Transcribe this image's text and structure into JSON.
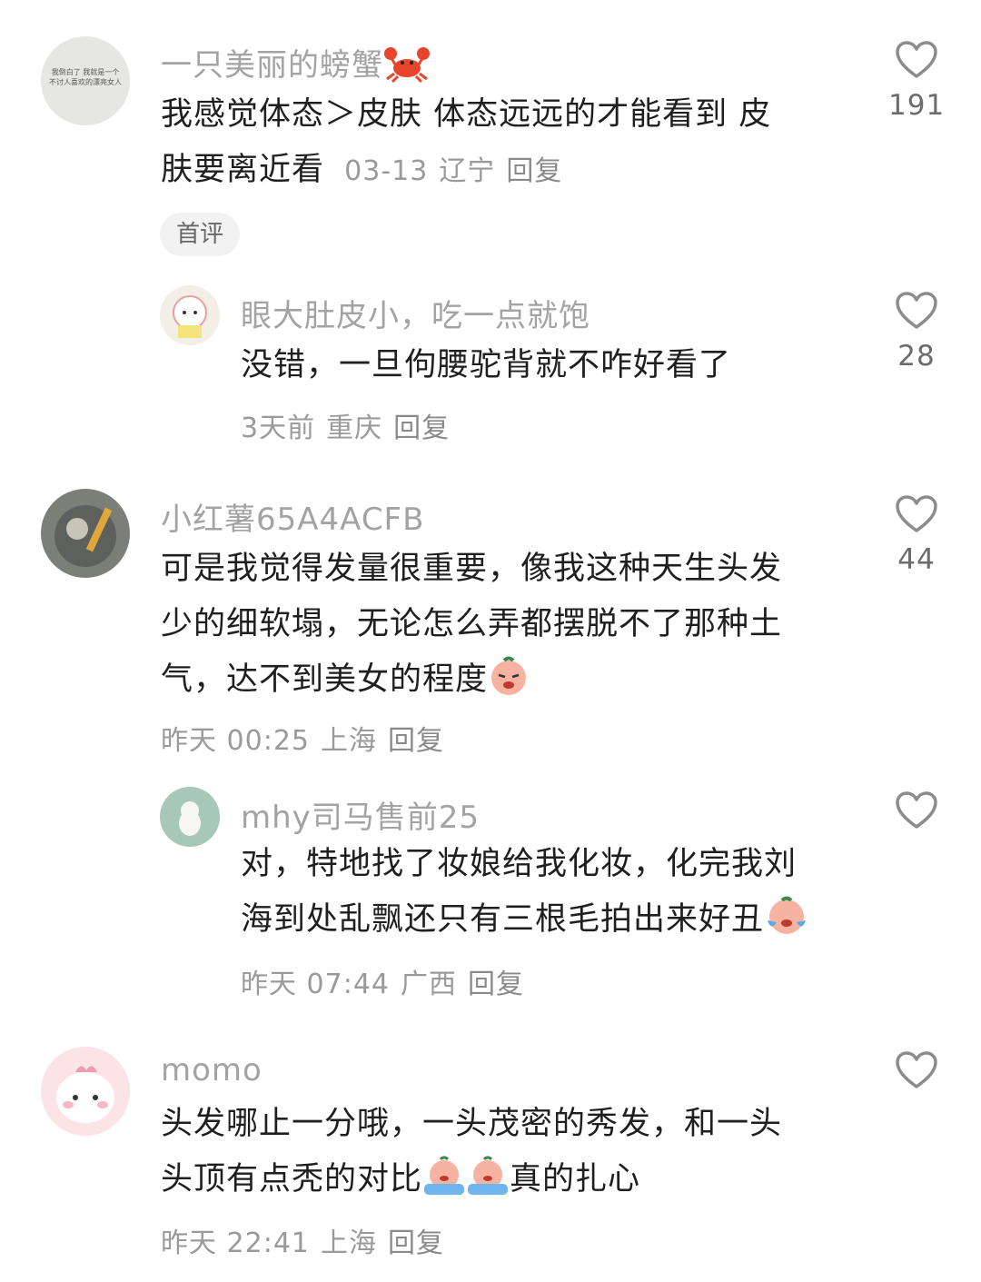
{
  "comments": [
    {
      "user": "一只美丽的螃蟹",
      "text_line1": "我感觉体态＞皮肤  体态远远的才能看到  皮",
      "text_line2": "肤要离近看",
      "date": "03-13",
      "location": "辽宁",
      "reply_label": "回复",
      "likes": "191",
      "badge": "首评",
      "avatar_text_1": "我倒白了 我就是一个",
      "avatar_text_2": "不讨人喜欢的漂亮女人"
    },
    {
      "user": "眼大肚皮小，吃一点就饱",
      "text": "没错，一旦佝腰驼背就不咋好看了",
      "date": "3天前",
      "location": "重庆",
      "reply_label": "回复",
      "likes": "28"
    },
    {
      "user": "小红薯65A4ACFB",
      "text_line1": "可是我觉得发量很重要，像我这种天生头发",
      "text_line2": "少的细软塌，无论怎么弄都摆脱不了那种土",
      "text_line3": "气，达不到美女的程度",
      "date": "昨天 00:25",
      "location": "上海",
      "reply_label": "回复",
      "likes": "44"
    },
    {
      "user": "mhy司马售前25",
      "text_line1": "对，特地找了妆娘给我化妆，化完我刘",
      "text_line2": "海到处乱飘还只有三根毛拍出来好丑",
      "date": "昨天 07:44",
      "location": "广西",
      "reply_label": "回复",
      "likes": ""
    },
    {
      "user": "momo",
      "text_line1": "头发哪止一分哦，一头茂密的秀发，和一头",
      "text_line2a": "头顶有点秃的对比",
      "text_line2b": "真的扎心",
      "date": "昨天 22:41",
      "location": "上海",
      "reply_label": "回复",
      "likes": ""
    }
  ],
  "colors": {
    "username": "#a3a3a3",
    "text": "#1f1f1f",
    "meta": "#9a9a9a",
    "heart": "#8c8c8c"
  },
  "icons": {
    "like": "heart-outline-icon",
    "crab": "crab-emoji",
    "cry": "crying-face-emoji"
  }
}
